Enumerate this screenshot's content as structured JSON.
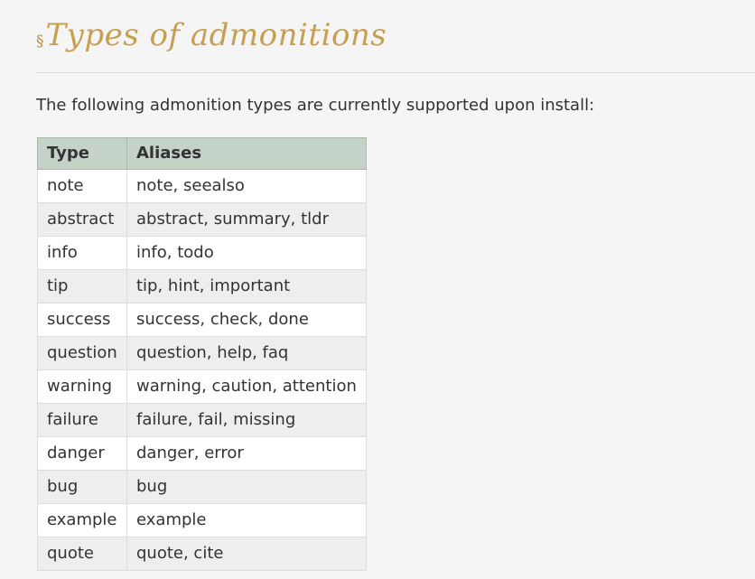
{
  "section": {
    "anchor_symbol": "§",
    "title": "Types of admonitions",
    "intro": "The following admonition types are currently supported upon install:"
  },
  "table": {
    "headers": [
      "Type",
      "Aliases"
    ],
    "rows": [
      {
        "type": "note",
        "aliases": "note, seealso"
      },
      {
        "type": "abstract",
        "aliases": "abstract, summary, tldr"
      },
      {
        "type": "info",
        "aliases": "info, todo"
      },
      {
        "type": "tip",
        "aliases": "tip, hint, important"
      },
      {
        "type": "success",
        "aliases": "success, check, done"
      },
      {
        "type": "question",
        "aliases": "question, help, faq"
      },
      {
        "type": "warning",
        "aliases": "warning, caution, attention"
      },
      {
        "type": "failure",
        "aliases": "failure, fail, missing"
      },
      {
        "type": "danger",
        "aliases": "danger, error"
      },
      {
        "type": "bug",
        "aliases": "bug"
      },
      {
        "type": "example",
        "aliases": "example"
      },
      {
        "type": "quote",
        "aliases": "quote, cite"
      }
    ]
  },
  "colors": {
    "heading": "#c79f51",
    "header_row": "#c5d2c8",
    "background": "#f5f5f5"
  }
}
